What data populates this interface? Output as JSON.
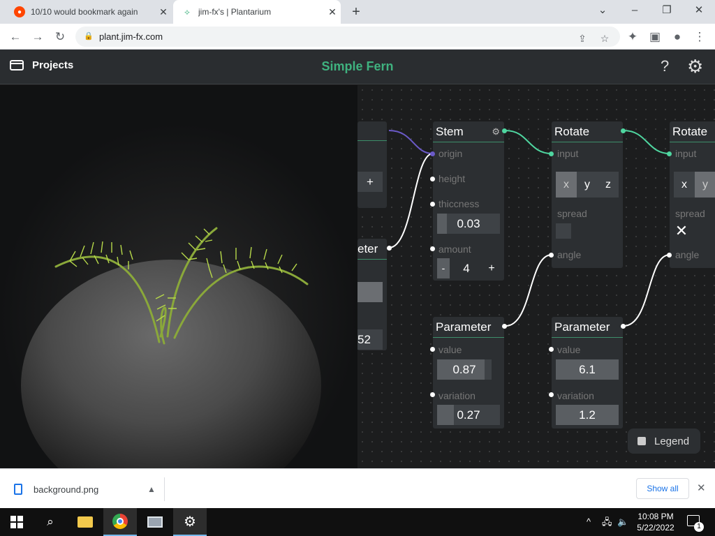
{
  "browser": {
    "tabs": [
      {
        "title": "10/10 would bookmark again",
        "favicon": "reddit-icon",
        "active": false
      },
      {
        "title": "jim-fx's | Plantarium",
        "favicon": "plant-icon",
        "active": true
      }
    ],
    "url": "plant.jim-fx.com"
  },
  "app": {
    "projects_label": "Projects",
    "title": "Simple Fern",
    "accent_color": "#3fb27f"
  },
  "nodes": {
    "partial_top": {
      "add_label": "+"
    },
    "partial_param": {
      "title": "eter",
      "value": "52"
    },
    "stem": {
      "title": "Stem",
      "origin_label": "origin",
      "height_label": "height",
      "thiccness_label": "thiccness",
      "thiccness_value": "0.03",
      "thiccness_fill": 0.15,
      "amount_label": "amount",
      "amount_minus": "-",
      "amount_value": "4",
      "amount_plus": "+"
    },
    "rotate1": {
      "title": "Rotate",
      "input_label": "input",
      "axis_x": "x",
      "axis_y": "y",
      "axis_z": "z",
      "spread_label": "spread",
      "angle_label": "angle"
    },
    "rotate2": {
      "title": "Rotate",
      "input_label": "input",
      "axis_x": "x",
      "axis_y": "y",
      "spread_label": "spread",
      "spread_mark": "✕",
      "angle_label": "angle"
    },
    "param1": {
      "title": "Parameter",
      "value_label": "value",
      "value": "0.87",
      "value_fill": 0.87,
      "variation_label": "variation",
      "variation": "0.27",
      "variation_fill": 0.27
    },
    "param2": {
      "title": "Parameter",
      "value_label": "value",
      "value": "6.1",
      "value_fill": 1.0,
      "variation_label": "variation",
      "variation": "1.2",
      "variation_fill": 1.0
    }
  },
  "legend_label": "Legend",
  "downloads": {
    "file": "background.png",
    "show_all": "Show all"
  },
  "taskbar": {
    "time": "10:08 PM",
    "date": "5/22/2022",
    "notification_count": "1"
  }
}
